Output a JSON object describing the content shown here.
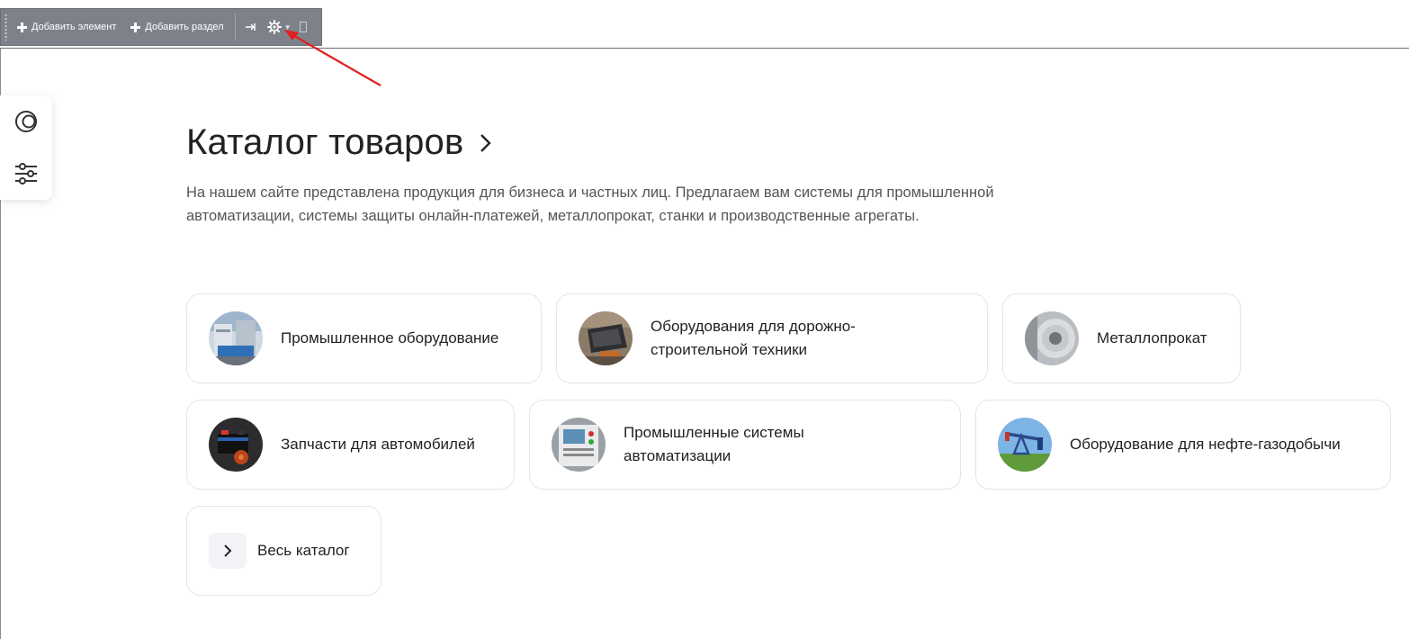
{
  "toolbar": {
    "add_element": "Добавить элемент",
    "add_section": "Добавить раздел"
  },
  "page": {
    "title": "Каталог товаров",
    "description": "На нашем сайте представлена продукция для бизнеса и частных лиц. Предлагаем вам системы для промышленной автоматизации, системы защиты онлайн-платежей, металлопрокат, станки и производственные агрегаты."
  },
  "categories": [
    {
      "label": "Промышленное оборудование",
      "icon": "industrial-equipment-thumb"
    },
    {
      "label": "Оборудования для дорожно-строительной техники",
      "icon": "road-machinery-thumb"
    },
    {
      "label": "Металлопрокат",
      "icon": "metal-roll-thumb"
    },
    {
      "label": "Запчасти для автомобилей",
      "icon": "car-parts-thumb"
    },
    {
      "label": "Промышленные системы автоматизации",
      "icon": "automation-panel-thumb"
    },
    {
      "label": "Оборудование для нефте-газодобычи",
      "icon": "oil-pump-thumb"
    }
  ],
  "all_catalog": {
    "label": "Весь каталог"
  },
  "colors": {
    "toolbar_bg": "#7d828a",
    "arrow": "#e02020",
    "card_border": "#e4e5e8",
    "text": "#222222",
    "muted": "#555555"
  }
}
